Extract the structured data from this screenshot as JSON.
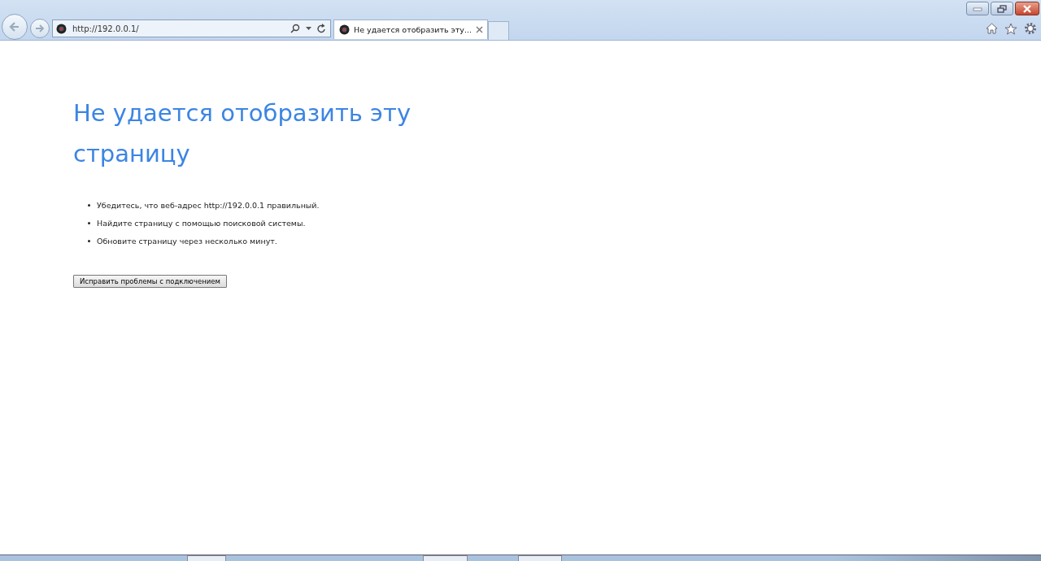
{
  "browser": {
    "address": "http://192.0.0.1/",
    "tabs": [
      {
        "title": "Не удается отобразить эту...",
        "selected": true
      }
    ]
  },
  "page": {
    "heading": "Не удается отобразить эту страницу",
    "bullets": [
      "Убедитесь, что веб-адрес http://192.0.0.1 правильный.",
      "Найдите страницу с помощью поисковой системы.",
      "Обновите страницу через несколько минут."
    ],
    "button": "Исправить проблемы с подключением"
  }
}
